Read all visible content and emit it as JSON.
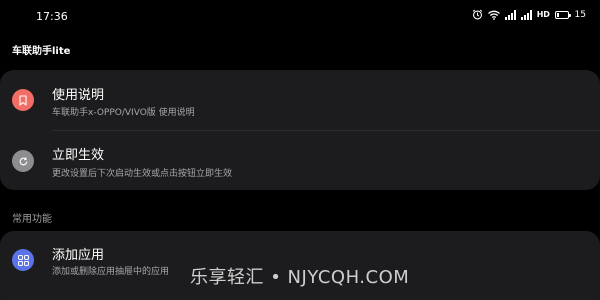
{
  "status_bar": {
    "time": "17:36",
    "hd_label": "HD",
    "battery_level": "15",
    "icons": [
      "alarm-icon",
      "wifi-icon",
      "signal-icon",
      "signal-icon",
      "hd-icon",
      "battery-icon"
    ]
  },
  "app": {
    "title": "车联助手lite"
  },
  "items": [
    {
      "icon": "bookmark-icon",
      "icon_color": "#f26d65",
      "title": "使用说明",
      "subtitle": "车联助手x-OPPO/VIVO版 使用说明"
    },
    {
      "icon": "refresh-icon",
      "icon_color": "#8d8d91",
      "title": "立即生效",
      "subtitle": "更改设置后下次启动生效或点击按钮立即生效"
    }
  ],
  "section": {
    "label": "常用功能"
  },
  "common_items": [
    {
      "icon": "apps-grid-icon",
      "icon_color": "#5b73e8",
      "title": "添加应用",
      "subtitle": "添加或删除应用抽屉中的应用"
    }
  ],
  "watermark": "乐享轻汇 • NJYCQH.COM"
}
